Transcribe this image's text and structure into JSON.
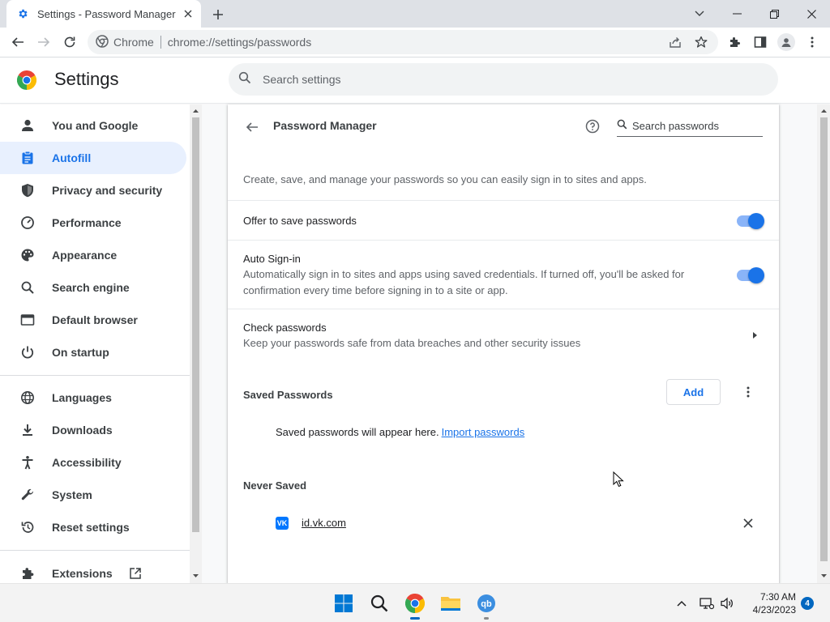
{
  "browser": {
    "tab_title": "Settings - Password Manager",
    "omnibox_site": "Chrome",
    "omnibox_url": "chrome://settings/passwords"
  },
  "settings": {
    "title": "Settings",
    "search_placeholder": "Search settings"
  },
  "sidebar": {
    "items": [
      {
        "label": "You and Google",
        "icon": "person-icon"
      },
      {
        "label": "Autofill",
        "icon": "clipboard-icon",
        "active": true
      },
      {
        "label": "Privacy and security",
        "icon": "shield-icon"
      },
      {
        "label": "Performance",
        "icon": "speedometer-icon"
      },
      {
        "label": "Appearance",
        "icon": "palette-icon"
      },
      {
        "label": "Search engine",
        "icon": "search-icon"
      },
      {
        "label": "Default browser",
        "icon": "browser-window-icon"
      },
      {
        "label": "On startup",
        "icon": "power-icon"
      },
      {
        "label": "Languages",
        "icon": "globe-icon"
      },
      {
        "label": "Downloads",
        "icon": "download-icon"
      },
      {
        "label": "Accessibility",
        "icon": "accessibility-icon"
      },
      {
        "label": "System",
        "icon": "wrench-icon"
      },
      {
        "label": "Reset settings",
        "icon": "reset-icon"
      },
      {
        "label": "Extensions",
        "icon": "puzzle-icon"
      }
    ]
  },
  "password_manager": {
    "title": "Password Manager",
    "search_placeholder": "Search passwords",
    "description": "Create, save, and manage your passwords so you can easily sign in to sites and apps.",
    "offer_to_save": {
      "label": "Offer to save passwords",
      "enabled": true
    },
    "auto_signin": {
      "label": "Auto Sign-in",
      "sublabel": "Automatically sign in to sites and apps using saved credentials. If turned off, you'll be asked for confirmation every time before signing in to a site or app.",
      "enabled": true
    },
    "check_passwords": {
      "label": "Check passwords",
      "sublabel": "Keep your passwords safe from data breaches and other security issues"
    },
    "saved_passwords": {
      "title": "Saved Passwords",
      "add_label": "Add",
      "empty_message": "Saved passwords will appear here.",
      "import_link": "Import passwords"
    },
    "never_saved": {
      "title": "Never Saved",
      "sites": [
        {
          "name": "id.vk.com",
          "icon_text": "VK"
        }
      ]
    }
  },
  "taskbar": {
    "time": "7:30 AM",
    "date": "4/23/2023",
    "notifications": "4",
    "apps": [
      "start-icon",
      "search-icon",
      "chrome-icon",
      "file-explorer-icon",
      "qbittorrent-icon"
    ]
  },
  "colors": {
    "accent": "#1a73e8",
    "active_nav_bg": "#e8f0fe",
    "toggle_track": "#8ab4f8"
  }
}
